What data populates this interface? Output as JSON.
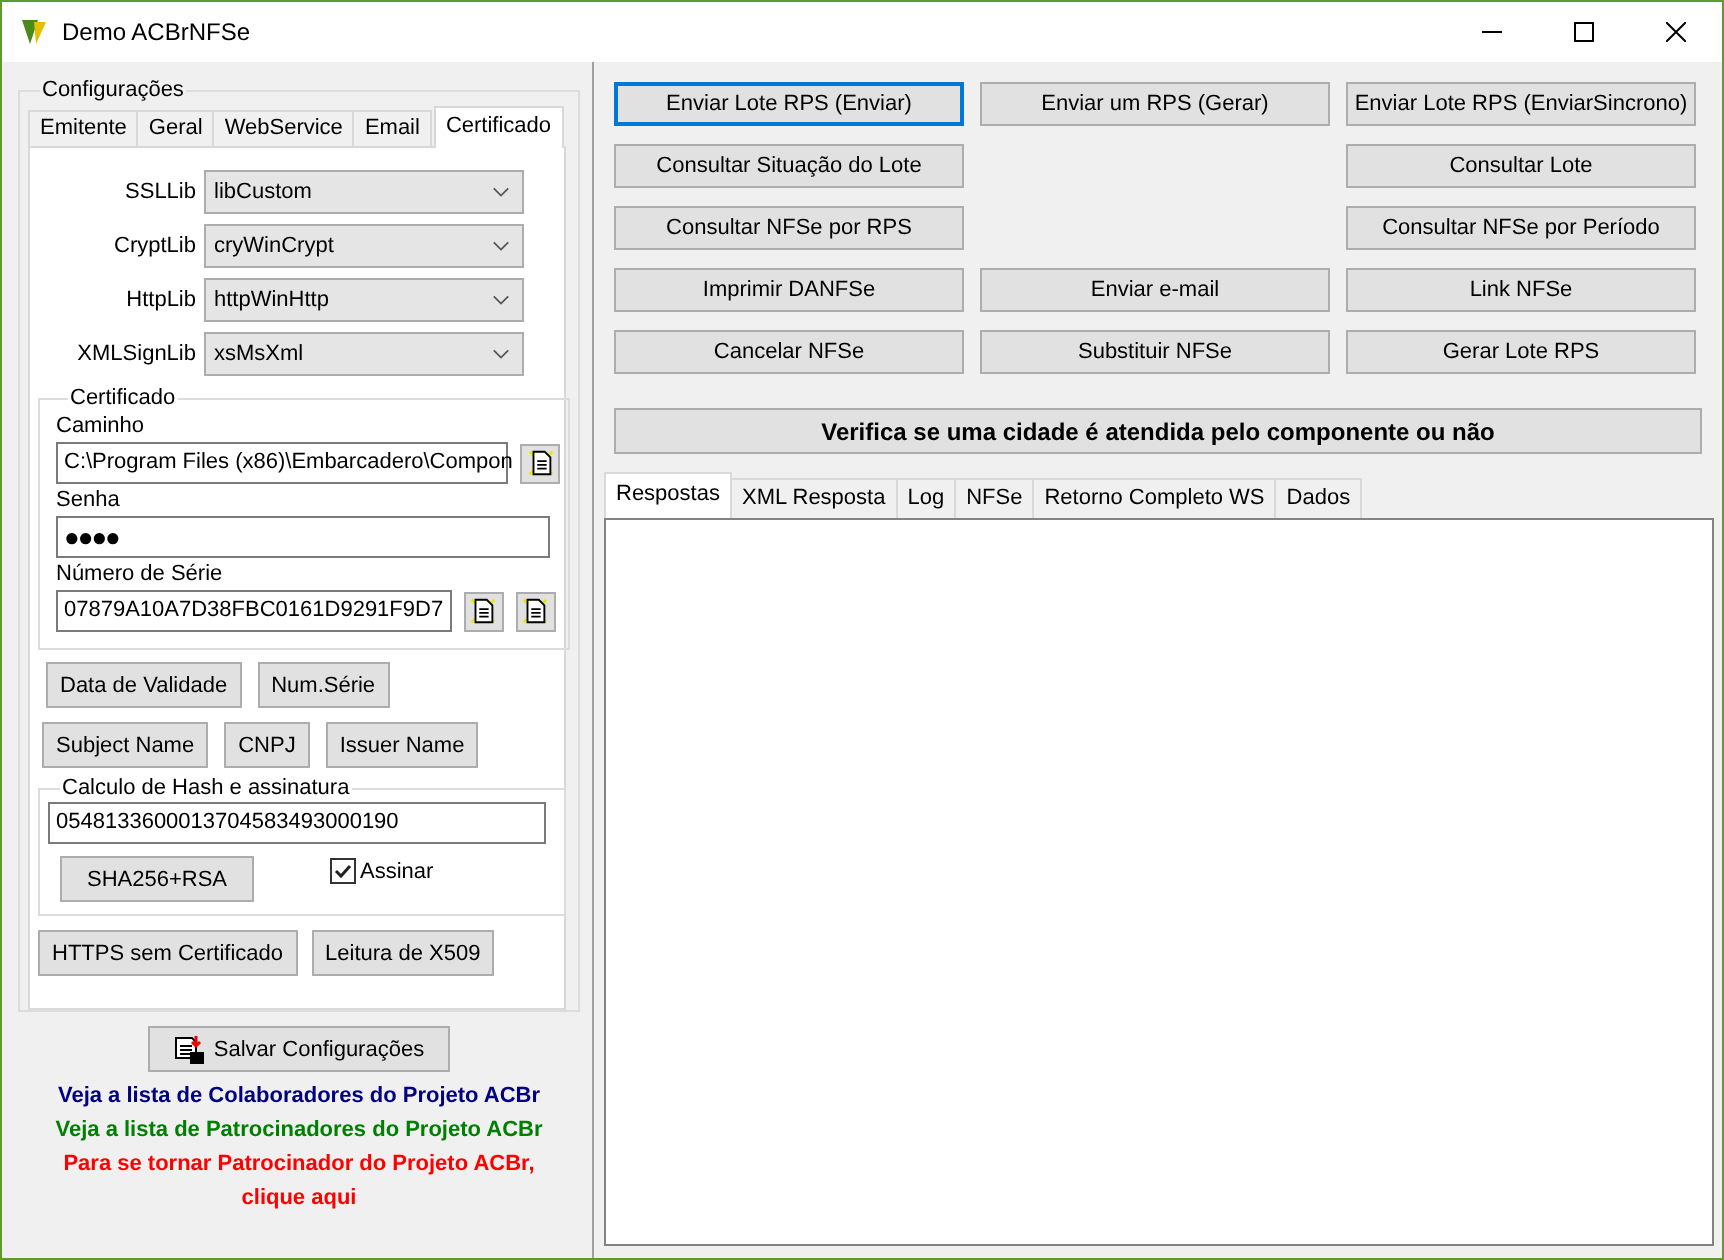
{
  "window": {
    "title": "Demo ACBrNFSe"
  },
  "config": {
    "title": "Configurações",
    "tabs": [
      {
        "label": "Emitente",
        "selected": false
      },
      {
        "label": "Geral",
        "selected": false
      },
      {
        "label": "WebService",
        "selected": false
      },
      {
        "label": "Email",
        "selected": false
      },
      {
        "label": "Certificado",
        "selected": true
      }
    ],
    "libs": [
      {
        "label": "SSLLib",
        "value": "libCustom"
      },
      {
        "label": "CryptLib",
        "value": "cryWinCrypt"
      },
      {
        "label": "HttpLib",
        "value": "httpWinHttp"
      },
      {
        "label": "XMLSignLib",
        "value": "xsMsXml"
      }
    ],
    "certificado": {
      "title": "Certificado",
      "caminho_label": "Caminho",
      "caminho_value": "C:\\Program Files (x86)\\Embarcadero\\Compon",
      "senha_label": "Senha",
      "senha_value": "●●●●",
      "numero_label": "Número de Série",
      "numero_value": "07879A10A7D38FBC0161D9291F9D7"
    },
    "cert_buttons": [
      [
        "Data de Validade",
        "Num.Série"
      ],
      [
        "Subject Name",
        "CNPJ",
        "Issuer Name"
      ]
    ],
    "hash": {
      "title": "Calculo de Hash e assinatura",
      "value": "0548133600013704583493000190",
      "button": "SHA256+RSA",
      "assinar": {
        "label": "Assinar",
        "checked": true
      }
    },
    "bottom_buttons": [
      "HTTPS sem Certificado",
      "Leitura de X509"
    ]
  },
  "save_button": "Salvar Configurações",
  "links": [
    {
      "text": "Veja a lista de Colaboradores do Projeto ACBr",
      "color": "#000080"
    },
    {
      "text": "Veja a lista de Patrocinadores do Projeto ACBr",
      "color": "#008000"
    },
    {
      "text": "Para se tornar Patrocinador do Projeto ACBr,",
      "color": "#ff0000"
    },
    {
      "text": "clique aqui",
      "color": "#ff0000"
    }
  ],
  "actions": [
    {
      "left": {
        "label": "Enviar Lote RPS (Enviar)",
        "focused": true
      },
      "center": {
        "label": "Enviar um RPS (Gerar)",
        "focused": false
      },
      "right": {
        "label": "Enviar Lote RPS (EnviarSincrono)",
        "focused": false
      }
    },
    {
      "left": {
        "label": "Consultar Situação do Lote",
        "focused": false
      },
      "right": {
        "label": "Consultar Lote",
        "focused": false
      }
    },
    {
      "left": {
        "label": "Consultar NFSe por RPS",
        "focused": false
      },
      "right": {
        "label": "Consultar NFSe por Período",
        "focused": false
      }
    },
    {
      "left": {
        "label": "Imprimir DANFSe",
        "focused": false
      },
      "center": {
        "label": "Enviar e-mail",
        "focused": false
      },
      "right": {
        "label": "Link NFSe",
        "focused": false
      }
    },
    {
      "left": {
        "label": "Cancelar NFSe",
        "focused": false
      },
      "center": {
        "label": "Substituir NFSe",
        "focused": false
      },
      "right": {
        "label": "Gerar Lote RPS",
        "focused": false
      }
    }
  ],
  "verify_button": "Verifica se uma cidade é atendida pelo componente ou não",
  "result_tabs": [
    {
      "label": "Respostas",
      "selected": true
    },
    {
      "label": "XML Resposta",
      "selected": false
    },
    {
      "label": "Log",
      "selected": false
    },
    {
      "label": "NFSe",
      "selected": false
    },
    {
      "label": "Retorno Completo WS",
      "selected": false
    },
    {
      "label": "Dados",
      "selected": false
    }
  ]
}
